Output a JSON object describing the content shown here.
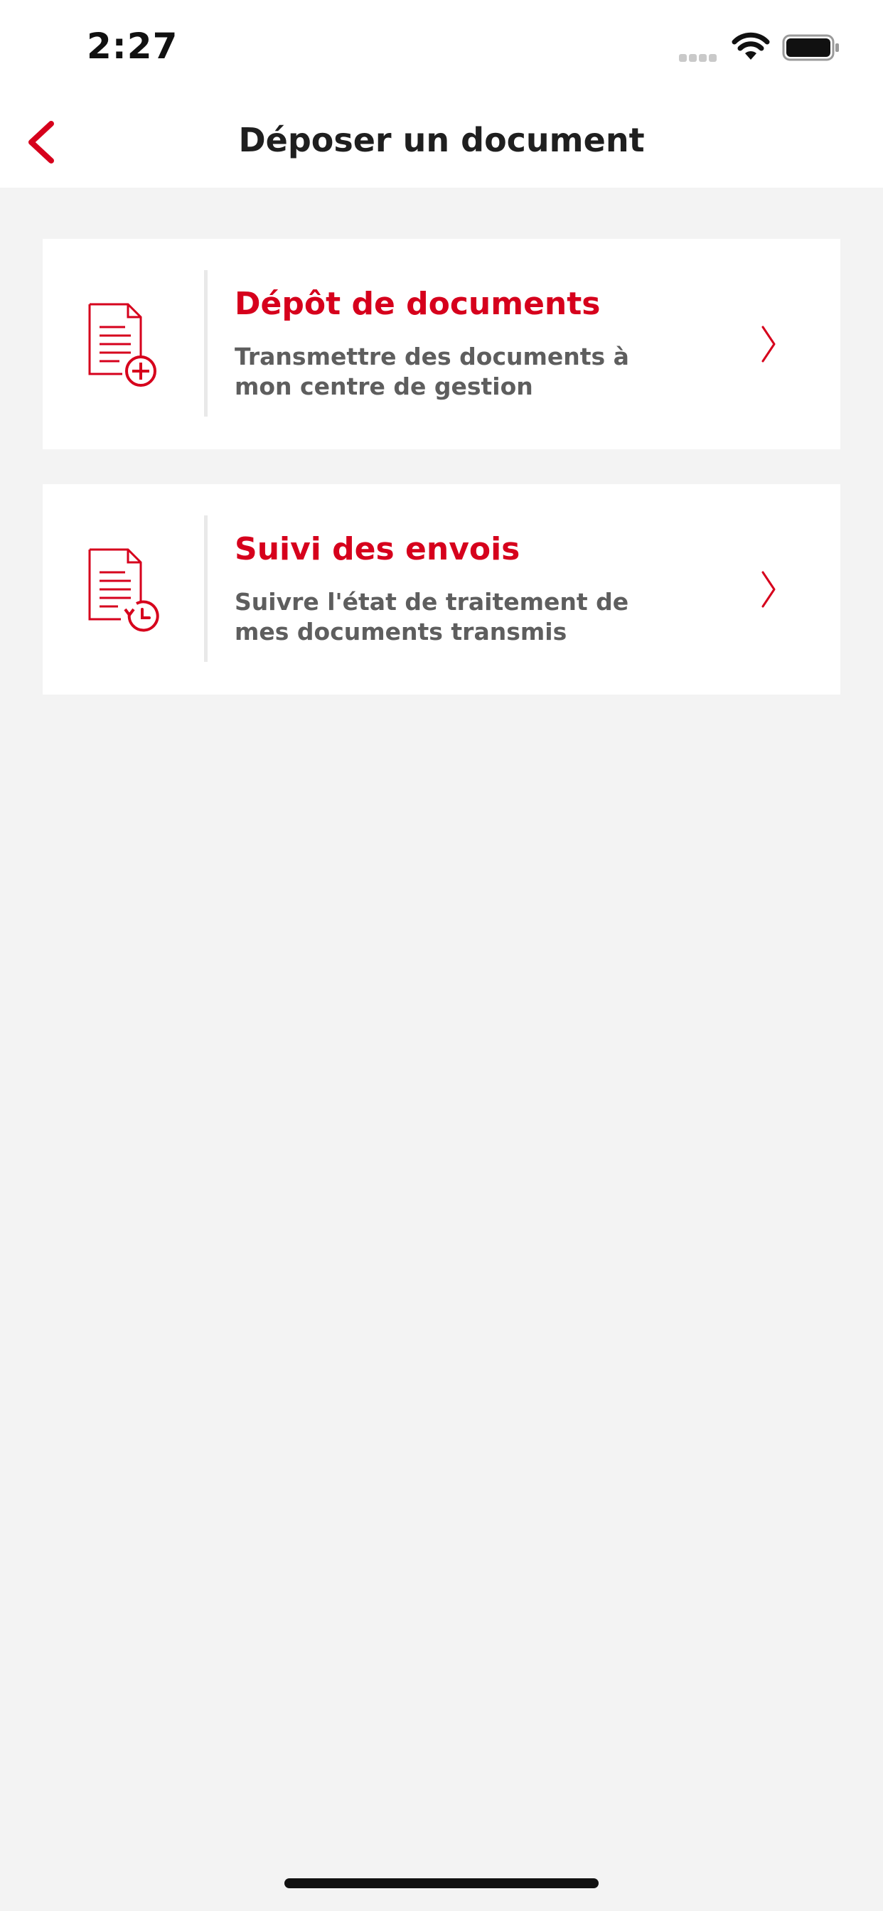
{
  "status_bar": {
    "time": "2:27",
    "icons": [
      "cellular-signal-icon",
      "wifi-icon",
      "battery-icon"
    ]
  },
  "nav": {
    "title": "Déposer un document",
    "back_icon": "chevron-left-icon"
  },
  "menu": [
    {
      "title": "Dépôt de documents",
      "description": "Transmettre des documents à mon centre de gestion",
      "icon": "document-add-icon"
    },
    {
      "title": "Suivi des envois",
      "description": "Suivre l'état de traitement de mes documents transmis",
      "icon": "document-history-icon"
    }
  ],
  "colors": {
    "accent": "#d6001c",
    "background": "#f3f3f3",
    "card": "#ffffff",
    "text_secondary": "#5e5e5e"
  }
}
